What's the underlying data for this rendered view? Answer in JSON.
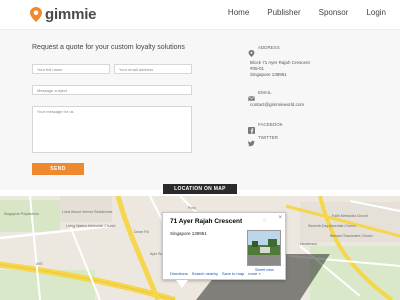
{
  "header": {
    "brand": "gimmie",
    "nav": [
      "Home",
      "Publisher",
      "Sponsor",
      "Login"
    ]
  },
  "form": {
    "title": "Request a quote for your custom loyalty solutions",
    "name_placeholder": "Your full name",
    "email_placeholder": "Your email address",
    "subject_placeholder": "Message subject",
    "message_placeholder": "Your message for us",
    "send_label": "SEND"
  },
  "contact": {
    "address_label": "ADDRESS",
    "address_lines": [
      "Block 71 Ayer Rajah Crescent",
      "#05-01",
      "Singapore 139951"
    ],
    "email_label": "EMAIL",
    "email": "contact@gimmieworld.com",
    "facebook_label": "FACEBOOK",
    "twitter_label": "TWITTER"
  },
  "location_button": "LOCATION ON MAP",
  "map": {
    "labels": [
      "Singapore Polytechnic",
      "Lions Mount Vernon Residences",
      "Living Waters Methodist Church",
      "Faith Methodist Church",
      "Seventh-Day Adventist Church",
      "Blessed Sacrament Church",
      "Henderson",
      "Pony",
      "Ayer Rajah",
      "Dover Rd",
      "AYE"
    ],
    "infowindow": {
      "title": "71 Ayer Rajah Crescent",
      "address": "Singapore 139951",
      "street_view": "Street view",
      "links": [
        "Directions",
        "Search nearby",
        "Save to map",
        "more »"
      ]
    }
  },
  "colors": {
    "accent": "#f0892e",
    "dark_button": "#2b2b2b",
    "road_yellow": "#f5d64c",
    "link_blue": "#1a4fb3"
  }
}
